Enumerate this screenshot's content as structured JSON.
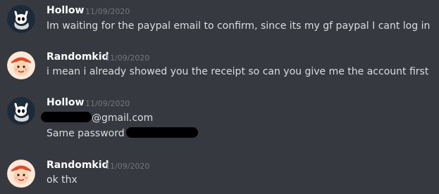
{
  "messages": [
    {
      "author": "Hollow",
      "timestamp": "11/09/2020",
      "avatar_icon": "hollow-knight-icon",
      "lines": [
        "Im waiting for the paypal email to confirm, since its my gf paypal I cant log in"
      ]
    },
    {
      "author": "Randomkid",
      "timestamp": "11/09/2020",
      "avatar_icon": "cartoon-kid-icon",
      "lines": [
        "i mean  i already showed you the receipt so can you give me the account first"
      ]
    },
    {
      "author": "Hollow",
      "timestamp": "11/09/2020",
      "avatar_icon": "hollow-knight-icon",
      "email_suffix": "@gmail.com",
      "password_prefix": "Same password"
    },
    {
      "author": "Randomkid",
      "timestamp": "11/09/2020",
      "avatar_icon": "cartoon-kid-icon",
      "lines": [
        "ok thx"
      ]
    }
  ],
  "colors": {
    "background": "#36393f",
    "username": "#ffffff",
    "timestamp": "#72767d",
    "text": "#dcddde",
    "redaction": "#000000"
  }
}
